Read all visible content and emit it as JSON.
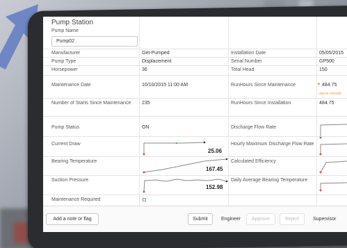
{
  "header": {
    "title": "Pump Station"
  },
  "pump_name": {
    "label": "Pump Name",
    "value": "Pump02"
  },
  "rows": [
    {
      "l1": "Manufacturer",
      "v1": "Get-Pumped",
      "l2": "Installation Date",
      "v2": "05/05/2015"
    },
    {
      "l1": "Pump Type",
      "v1": "Displacement",
      "l2": "Serial Number",
      "v2": "GP500"
    },
    {
      "l1": "Horsepower",
      "v1": "36",
      "l2": "Total Head",
      "v2": "150"
    }
  ],
  "maintenance": {
    "date_label": "Maintenance Date",
    "date_value": "10/10/2015 11:00 AM",
    "runhours_maint_label": "RunHours Since Maintenance",
    "runhours_maint_value": "484.75",
    "runhours_maint_warning": "above manufa",
    "starts_label": "Number of Starts Since Maintenance",
    "starts_value": "235",
    "runhours_install_label": "RunHours Since Installation",
    "runhours_install_value": "484.75"
  },
  "telemetry": {
    "status_label": "Pump Status",
    "status_value": "ON",
    "discharge_label": "Discharge Flow Rate",
    "current_label": "Current Draw",
    "current_value": "25.06",
    "hourly_label": "Hourly Maximum Discharge Flow Rate",
    "bearing_label": "Bearing Temperature",
    "bearing_value": "167.45",
    "efficiency_label": "Calculated Efficiency",
    "suction_label": "Suction Pressure",
    "suction_value": "152.98",
    "daily_label": "Daily Average Bearing Temperature",
    "maint_required_label": "Maintenance Required"
  },
  "footer": {
    "note_button": "Add a note or flag",
    "submit": "Submit",
    "engineer": "Engineer",
    "approve": "Approve",
    "reject": "Reject",
    "supervisor": "Supervisor"
  },
  "colors": {
    "arrow": "#6f86c4",
    "warning": "#e8a23a",
    "spark_start": "#d9534f",
    "spark_end": "#5cb85c"
  }
}
